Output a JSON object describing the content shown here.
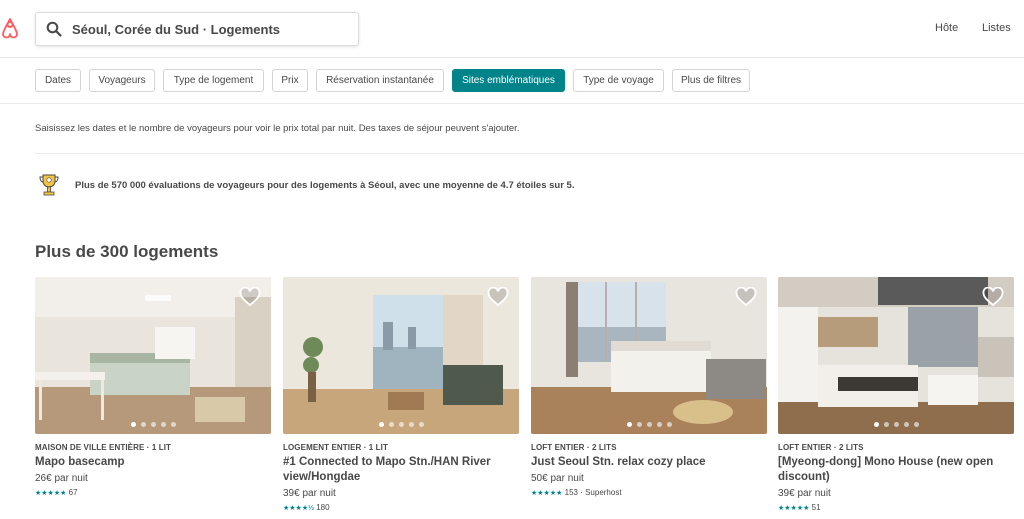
{
  "header": {
    "search_text": "Séoul, Corée du Sud · Logements",
    "nav": [
      "Hôte",
      "Listes"
    ]
  },
  "filters": [
    "Dates",
    "Voyageurs",
    "Type de logement",
    "Prix",
    "Réservation instantanée",
    "Sites emblématiques",
    "Type de voyage",
    "Plus de filtres"
  ],
  "active_filter": "Sites emblématiques",
  "notice": "Saisissez les dates et le nombre de voyageurs pour voir le prix total par nuit. Des taxes de séjour peuvent s'ajouter.",
  "reviews_banner": "Plus de 570 000 évaluations de voyageurs pour des logements à Séoul, avec une moyenne de 4.7 étoiles sur 5.",
  "section_title": "Plus de 300 logements",
  "listings": [
    {
      "kind": "MAISON DE VILLE ENTIÈRE · 1 LIT",
      "name": "Mapo basecamp",
      "price": "26€ par nuit",
      "stars": "★★★★★",
      "rating": "67"
    },
    {
      "kind": "LOGEMENT ENTIER · 1 LIT",
      "name": "#1 Connected to Mapo Stn./HAN River view/Hongdae",
      "price": "39€ par nuit",
      "stars": "★★★★½",
      "rating": "180"
    },
    {
      "kind": "LOFT ENTIER · 2 LITS",
      "name": "Just Seoul Stn. relax cozy place",
      "price": "50€ par nuit",
      "stars": "★★★★★",
      "rating": "153 · Superhost"
    },
    {
      "kind": "LOFT ENTIER · 2 LITS",
      "name": "[Myeong-dong] Mono House (new open discount)",
      "price": "39€ par nuit",
      "stars": "★★★★★",
      "rating": "51"
    }
  ],
  "colors": {
    "accent": "#008489",
    "brand": "#FF5A5F",
    "text": "#484848"
  },
  "icons": [
    "airbnb-logo-icon",
    "search-icon",
    "trophy-icon",
    "heart-icon"
  ]
}
